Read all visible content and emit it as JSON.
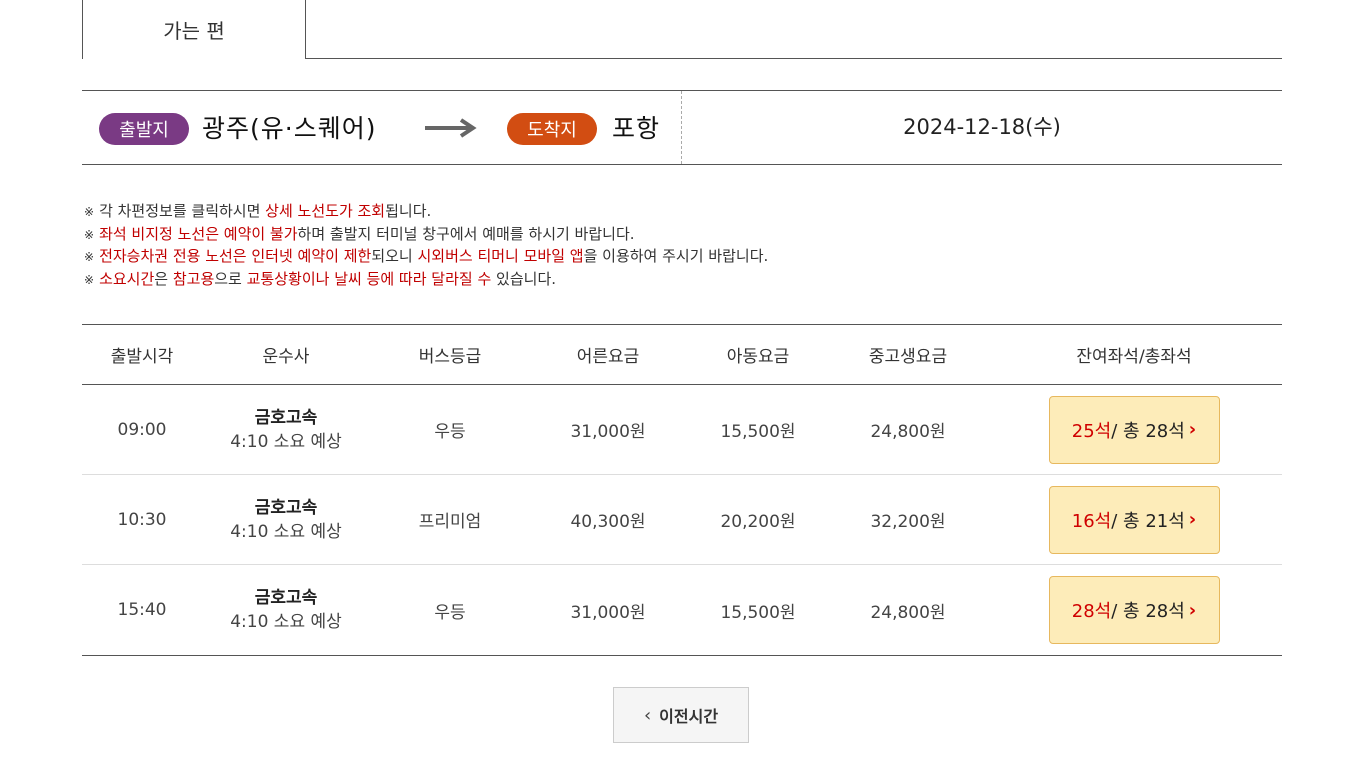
{
  "tab": {
    "label": "가는 편"
  },
  "route": {
    "departure_badge": "출발지",
    "departure": "광주(유·스퀘어)",
    "arrival_badge": "도착지",
    "arrival": "포항",
    "date": "2024-12-18(수)",
    "colors": {
      "departure_badge": "#7a3a84",
      "arrival_badge": "#d24d12"
    }
  },
  "notices": [
    {
      "parts": [
        {
          "text": "각 차편정보를 클릭하시면 ",
          "red": false
        },
        {
          "text": "상세 노선도가 조회",
          "red": true
        },
        {
          "text": "됩니다.",
          "red": false
        }
      ]
    },
    {
      "parts": [
        {
          "text": "좌석 비지정 노선은 예약이 불가",
          "red": true
        },
        {
          "text": "하며 출발지 터미널 창구에서 예매를 하시기 바랍니다.",
          "red": false
        }
      ]
    },
    {
      "parts": [
        {
          "text": "전자승차권 전용 노선은 인터넷 예약이 제한",
          "red": true
        },
        {
          "text": "되오니 ",
          "red": false
        },
        {
          "text": "시외버스 티머니 모바일 앱",
          "red": true
        },
        {
          "text": "을 이용하여 주시기 바랍니다.",
          "red": false
        }
      ]
    },
    {
      "parts": [
        {
          "text": "소요시간",
          "red": true
        },
        {
          "text": "은 ",
          "red": false
        },
        {
          "text": "참고용",
          "red": true
        },
        {
          "text": "으로 ",
          "red": false
        },
        {
          "text": "교통상황이나 날씨 등에 따라 달라질 수",
          "red": true
        },
        {
          "text": " 있습니다.",
          "red": false
        }
      ]
    }
  ],
  "notice_mark": "※",
  "table": {
    "headers": [
      "출발시각",
      "운수사",
      "버스등급",
      "어른요금",
      "아동요금",
      "중고생요금",
      "잔여좌석/총좌석"
    ],
    "rows": [
      {
        "time": "09:00",
        "company": "금호고속",
        "duration": "4:10 소요 예상",
        "grade": "우등",
        "adult": "31,000원",
        "child": "15,500원",
        "youth": "24,800원",
        "remain": "25석",
        "total": " / 총 28석"
      },
      {
        "time": "10:30",
        "company": "금호고속",
        "duration": "4:10 소요 예상",
        "grade": "프리미엄",
        "adult": "40,300원",
        "child": "20,200원",
        "youth": "32,200원",
        "remain": "16석",
        "total": " / 총 21석"
      },
      {
        "time": "15:40",
        "company": "금호고속",
        "duration": "4:10 소요 예상",
        "grade": "우등",
        "adult": "31,000원",
        "child": "15,500원",
        "youth": "24,800원",
        "remain": "28석",
        "total": " / 총 28석"
      }
    ]
  },
  "prev_button": {
    "icon": "chevron-left-icon",
    "label": "이전시간"
  }
}
